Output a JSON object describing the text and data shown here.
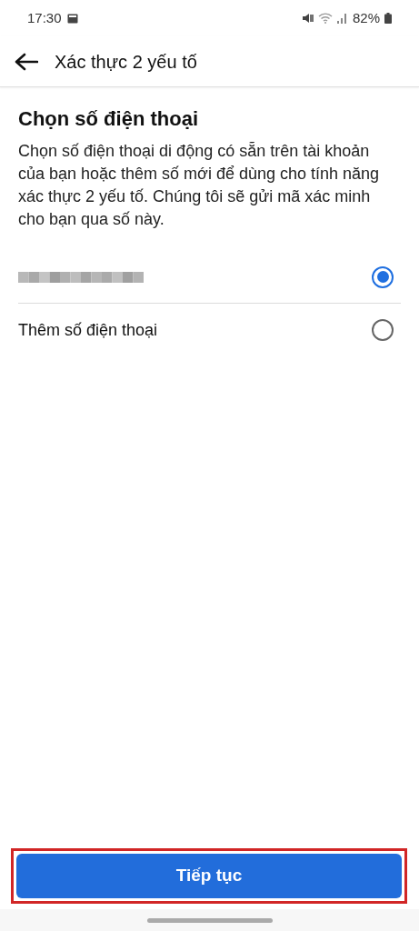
{
  "status_bar": {
    "time": "17:30",
    "battery": "82%"
  },
  "header": {
    "title": "Xác thực 2 yếu tố"
  },
  "heading": "Chọn số điện thoại",
  "description": "Chọn số điện thoại di động có sẵn trên tài khoản của bạn hoặc thêm số mới để dùng cho tính năng xác thực 2 yếu tố. Chúng tôi sẽ gửi mã xác minh cho bạn qua số này.",
  "options": [
    {
      "kind": "masked",
      "selected": true
    },
    {
      "kind": "text",
      "label": "Thêm số điện thoại",
      "selected": false
    }
  ],
  "button": {
    "label": "Tiếp tục",
    "highlighted": true
  }
}
